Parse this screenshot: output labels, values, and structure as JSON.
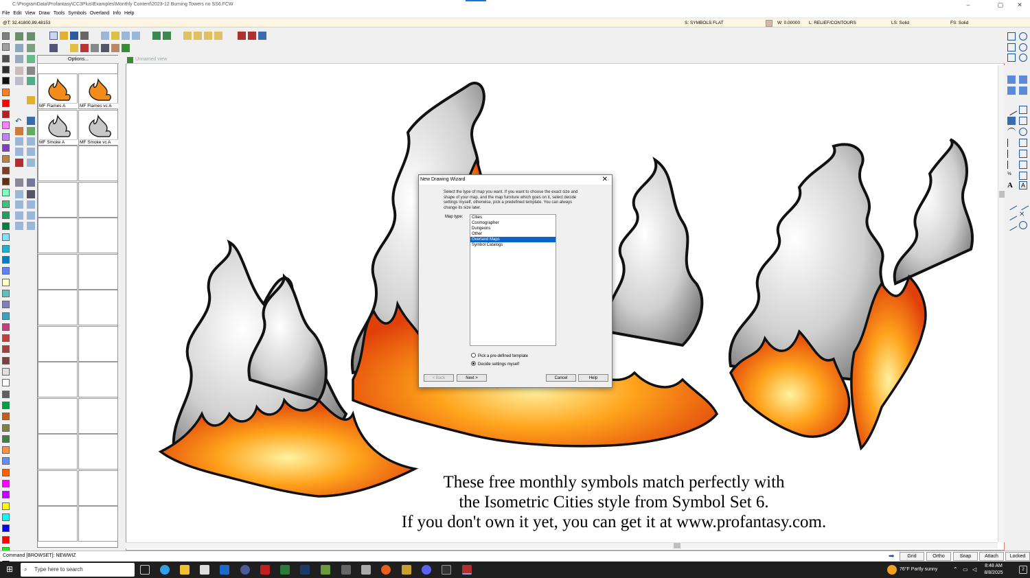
{
  "titlebar": {
    "path": "C:\\ProgramData\\Profantasy\\CC3Plus\\Examples\\Monthly Content\\2023-12 Burning Towers no SS6.FCW",
    "minimize": "–",
    "maximize": "▢",
    "close": "✕"
  },
  "menu": [
    "File",
    "Edit",
    "View",
    "Draw",
    "Tools",
    "Symbols",
    "Overland",
    "Info",
    "Help"
  ],
  "status": {
    "coords": "@T: 32.41800,89.48153",
    "sheet": "S: SYMBOLS FLAT",
    "width": "W: 0.00000",
    "layer": "L: RELIEF/CONTOURS",
    "linestyle": "LS: Solid",
    "fillstyle": "FS: Solid"
  },
  "symbols": {
    "options_label": "Options...",
    "items": [
      "MF Flames A",
      "MF Flames vc A",
      "MF Smoke A",
      "MF Smoke vc A"
    ]
  },
  "drawing": {
    "title": "Unnamed view"
  },
  "caption": [
    "These free monthly symbols match perfectly with",
    "the Isometric Cities style from Symbol Set 6.",
    "If you don't own it yet, you can get it at www.profantasy.com."
  ],
  "dialog": {
    "title": "New Drawing Wizard",
    "close": "✕",
    "description": "Select the type of map you want. If you want to choose the exact size and shape of your map, and the map furniture which goes on it, select decide settings myself, otherwise, pick a predefined template. You can always change its size later.",
    "map_type_label": "Map type:",
    "map_types": [
      "Cities",
      "Cosmographer",
      "Dungeons",
      "Other",
      "Overland Maps",
      "Symbol Catalogs"
    ],
    "selected": "Overland Maps",
    "radio_template": "Pick a pre-defined template",
    "radio_custom": "Decide settings myself",
    "back": "< Back",
    "next": "Next >",
    "cancel": "Cancel",
    "help": "Help"
  },
  "cmd": {
    "prompt": "Command [BROWSET]: NEWWIZ",
    "grid": "Grid",
    "ortho": "Ortho",
    "snap": "Snap",
    "attach": "Attach",
    "locked": "Locked"
  },
  "taskbar": {
    "search": "Type here to search",
    "weather": "76°F  Partly sunny",
    "time": "8:48 AM",
    "date": "8/8/2025"
  },
  "colors": {
    "accent": "#0a64c8",
    "flame": "#f28c1a",
    "smoke": "#c8c8c8",
    "palette": [
      "#7f7f7f",
      "#a0a0a0",
      "#4f4f4f",
      "#2f2f2f",
      "#101010",
      "#ff7f27",
      "#ff0000",
      "#b22222",
      "#ff80ff",
      "#c080ff",
      "#8040c0",
      "#c08040",
      "#804020",
      "#603010",
      "#80ffc0",
      "#40c080",
      "#20a060",
      "#008040",
      "#80e0ff",
      "#20b0d0",
      "#0080c0",
      "#6080ff",
      "#ffffc0",
      "#60c0c0",
      "#8080c0",
      "#40a0c0",
      "#c04080",
      "#c04040",
      "#a04040",
      "#804040",
      "#e0e0e0",
      "#ffffff",
      "#606060",
      "#00a040",
      "#c06020",
      "#808040",
      "#408040",
      "#ff9040",
      "#6090ff",
      "#ff6000",
      "#ff00ff",
      "#c000ff",
      "#ffff00",
      "#00ffff",
      "#0000ff",
      "#ff0000",
      "#00ff00",
      "#000000"
    ]
  }
}
